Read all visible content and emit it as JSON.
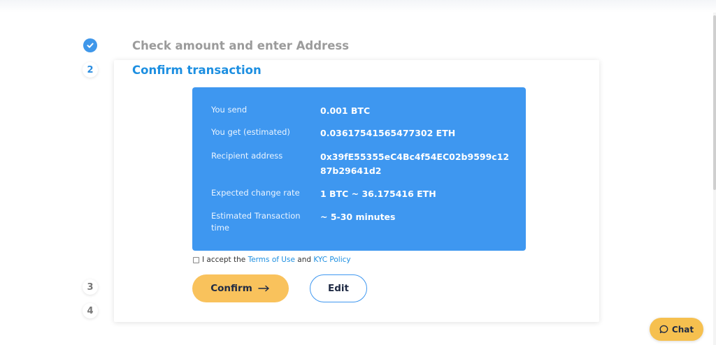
{
  "steps": {
    "step1": {
      "title": "Check amount and enter Address"
    },
    "step2": {
      "number": "2",
      "title": "Confirm transaction"
    },
    "step3": {
      "number": "3"
    },
    "step4": {
      "number": "4"
    }
  },
  "summary": {
    "rows": [
      {
        "label": "You send",
        "value": "0.001 BTC"
      },
      {
        "label": "You get (estimated)",
        "value": "0.03617541565477302 ETH"
      },
      {
        "label": "Recipient address",
        "value": "0x39fE55355eC4Bc4f54EC02b9599c1287b29641d2"
      },
      {
        "label": "Expected change rate",
        "value": "1 BTC ~ 36.175416 ETH"
      },
      {
        "label": "Estimated Transaction time",
        "value": "~ 5-30 minutes"
      }
    ]
  },
  "accept": {
    "prefix": "I accept the",
    "terms_link": "Terms of Use",
    "and": "and",
    "kyc_link": "KYC Policy",
    "checked": false
  },
  "buttons": {
    "confirm_label": "Confirm",
    "edit_label": "Edit"
  },
  "chat": {
    "label": "Chat"
  },
  "colors": {
    "accent_blue": "#3e97f0",
    "link_blue": "#1d8fe1",
    "button_yellow": "#f9c25c",
    "inactive_gray": "#9b9b9b"
  }
}
